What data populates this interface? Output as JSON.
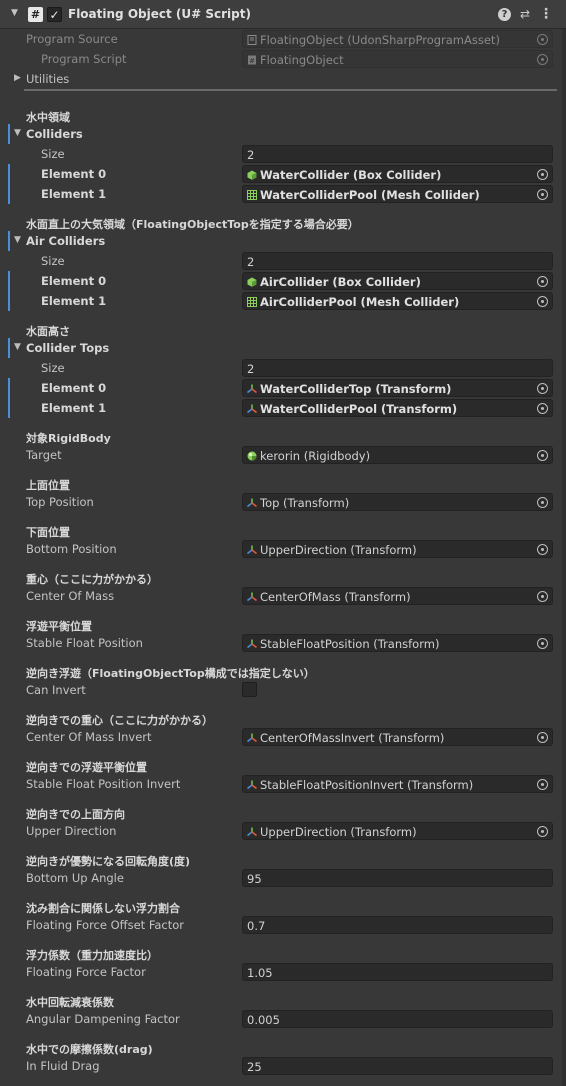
{
  "header": {
    "title": "Floating Object (U# Script)",
    "fold_icon": "foldout-arrow-down-icon",
    "script_icon": "#",
    "check": "✓",
    "help_icon": "?",
    "preset_icon": "⇄",
    "more_icon": "⋮"
  },
  "program": {
    "source_label": "Program Source",
    "source_value": "FloatingObject (UdonSharpProgramAsset)",
    "script_label": "Program Script",
    "script_value": "FloatingObject",
    "utilities_label": "Utilities"
  },
  "colliders": {
    "heading": "水中領域",
    "label": "Colliders",
    "size_label": "Size",
    "size": "2",
    "elements": [
      {
        "label": "Element 0",
        "value": "WaterCollider (Box Collider)",
        "icon": "box-collider-icon"
      },
      {
        "label": "Element 1",
        "value": "WaterColliderPool (Mesh Collider)",
        "icon": "mesh-collider-icon"
      }
    ]
  },
  "air_colliders": {
    "heading": "水面直上の大気領域（FloatingObjectTopを指定する場合必要）",
    "label": "Air Colliders",
    "size_label": "Size",
    "size": "2",
    "elements": [
      {
        "label": "Element 0",
        "value": "AirCollider (Box Collider)",
        "icon": "box-collider-icon"
      },
      {
        "label": "Element 1",
        "value": "AirColliderPool (Mesh Collider)",
        "icon": "mesh-collider-icon"
      }
    ]
  },
  "collider_tops": {
    "heading": "水面高さ",
    "label": "Collider Tops",
    "size_label": "Size",
    "size": "2",
    "elements": [
      {
        "label": "Element 0",
        "value": "WaterColliderTop (Transform)",
        "icon": "transform-icon"
      },
      {
        "label": "Element 1",
        "value": "WaterColliderPool (Transform)",
        "icon": "transform-icon"
      }
    ]
  },
  "fields": [
    {
      "heading": "対象RigidBody",
      "label": "Target",
      "value": "kerorin (Rigidbody)",
      "type": "object",
      "icon": "rigidbody-icon"
    },
    {
      "heading": "上面位置",
      "label": "Top Position",
      "value": "Top (Transform)",
      "type": "object",
      "icon": "transform-icon"
    },
    {
      "heading": "下面位置",
      "label": "Bottom Position",
      "value": "UpperDirection (Transform)",
      "type": "object",
      "icon": "transform-icon"
    },
    {
      "heading": "重心（ここに力がかかる）",
      "label": "Center Of Mass",
      "value": "CenterOfMass (Transform)",
      "type": "object",
      "icon": "transform-icon"
    },
    {
      "heading": "浮遊平衡位置",
      "label": "Stable Float Position",
      "value": "StableFloatPosition (Transform)",
      "type": "object",
      "icon": "transform-icon"
    },
    {
      "heading": "逆向き浮遊（FloatingObjectTop構成では指定しない）",
      "label": "Can Invert",
      "value": "",
      "type": "checkbox",
      "checked": false
    },
    {
      "heading": "逆向きでの重心（ここに力がかかる）",
      "label": "Center Of Mass Invert",
      "value": "CenterOfMassInvert (Transform)",
      "type": "object",
      "icon": "transform-icon"
    },
    {
      "heading": "逆向きでの浮遊平衡位置",
      "label": "Stable Float Position Invert",
      "value": "StableFloatPositionInvert (Transform)",
      "type": "object",
      "icon": "transform-icon"
    },
    {
      "heading": "逆向きでの上面方向",
      "label": "Upper Direction",
      "value": "UpperDirection (Transform)",
      "type": "object",
      "icon": "transform-icon"
    },
    {
      "heading": "逆向きが優勢になる回転角度(度)",
      "label": "Bottom Up Angle",
      "value": "95",
      "type": "number"
    },
    {
      "heading": "沈み割合に関係しない浮力割合",
      "label": "Floating Force Offset Factor",
      "value": "0.7",
      "type": "number"
    },
    {
      "heading": "浮力係数（重力加速度比）",
      "label": "Floating Force Factor",
      "value": "1.05",
      "type": "number"
    },
    {
      "heading": "水中回転減衰係数",
      "label": "Angular Dampening Factor",
      "value": "0.005",
      "type": "number"
    },
    {
      "heading": "水中での摩擦係数(drag)",
      "label": "In Fluid Drag",
      "value": "25",
      "type": "number"
    }
  ],
  "colors": {
    "background": "#383838",
    "field": "#2a2a2a",
    "accent_bar": "#4a8fd8",
    "collider_green": "#8bd05a",
    "transform_axes": [
      "#e0573a",
      "#6cc04a",
      "#4a8fd8"
    ]
  }
}
